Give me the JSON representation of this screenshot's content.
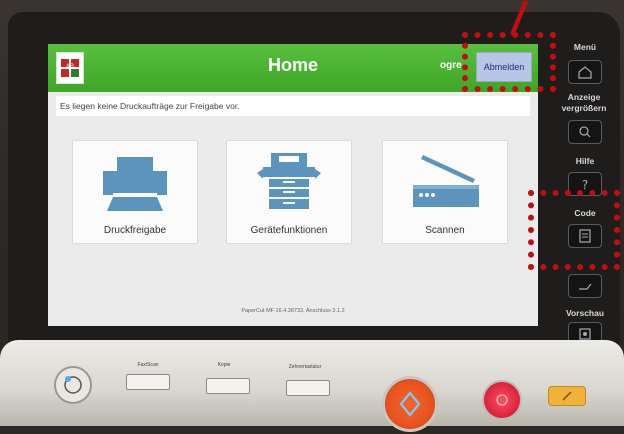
{
  "screen": {
    "header": {
      "title": "Home",
      "username": "ogre",
      "logout_label": "Abmelden"
    },
    "message": "Es liegen keine Druckaufträge zur Freigabe vor.",
    "tiles": [
      {
        "label": "Druckfreigabe",
        "icon": "printer-icon"
      },
      {
        "label": "Gerätefunktionen",
        "icon": "copier-icon"
      },
      {
        "label": "Scannen",
        "icon": "scanner-icon"
      }
    ],
    "footer": "PaperCut MF 16.4.38733, Anschluss 3.1.2"
  },
  "side_panel": {
    "menu_label": "Menü",
    "zoom_label": "Anzeige vergrößern",
    "help_label": "Hilfe",
    "code_label": "Code",
    "preview_label": "Vorschau"
  },
  "hardware": {
    "fax_scan_label": "Fax/Scan",
    "copy_label": "Kopie",
    "keyboard_label": "Zehnertastatur"
  },
  "colors": {
    "header_green": "#45ad2a",
    "tile_icon_blue": "#5b95bd",
    "highlight_red": "#c40d12",
    "start_orange": "#e8531f",
    "stop_red": "#d9223a"
  }
}
